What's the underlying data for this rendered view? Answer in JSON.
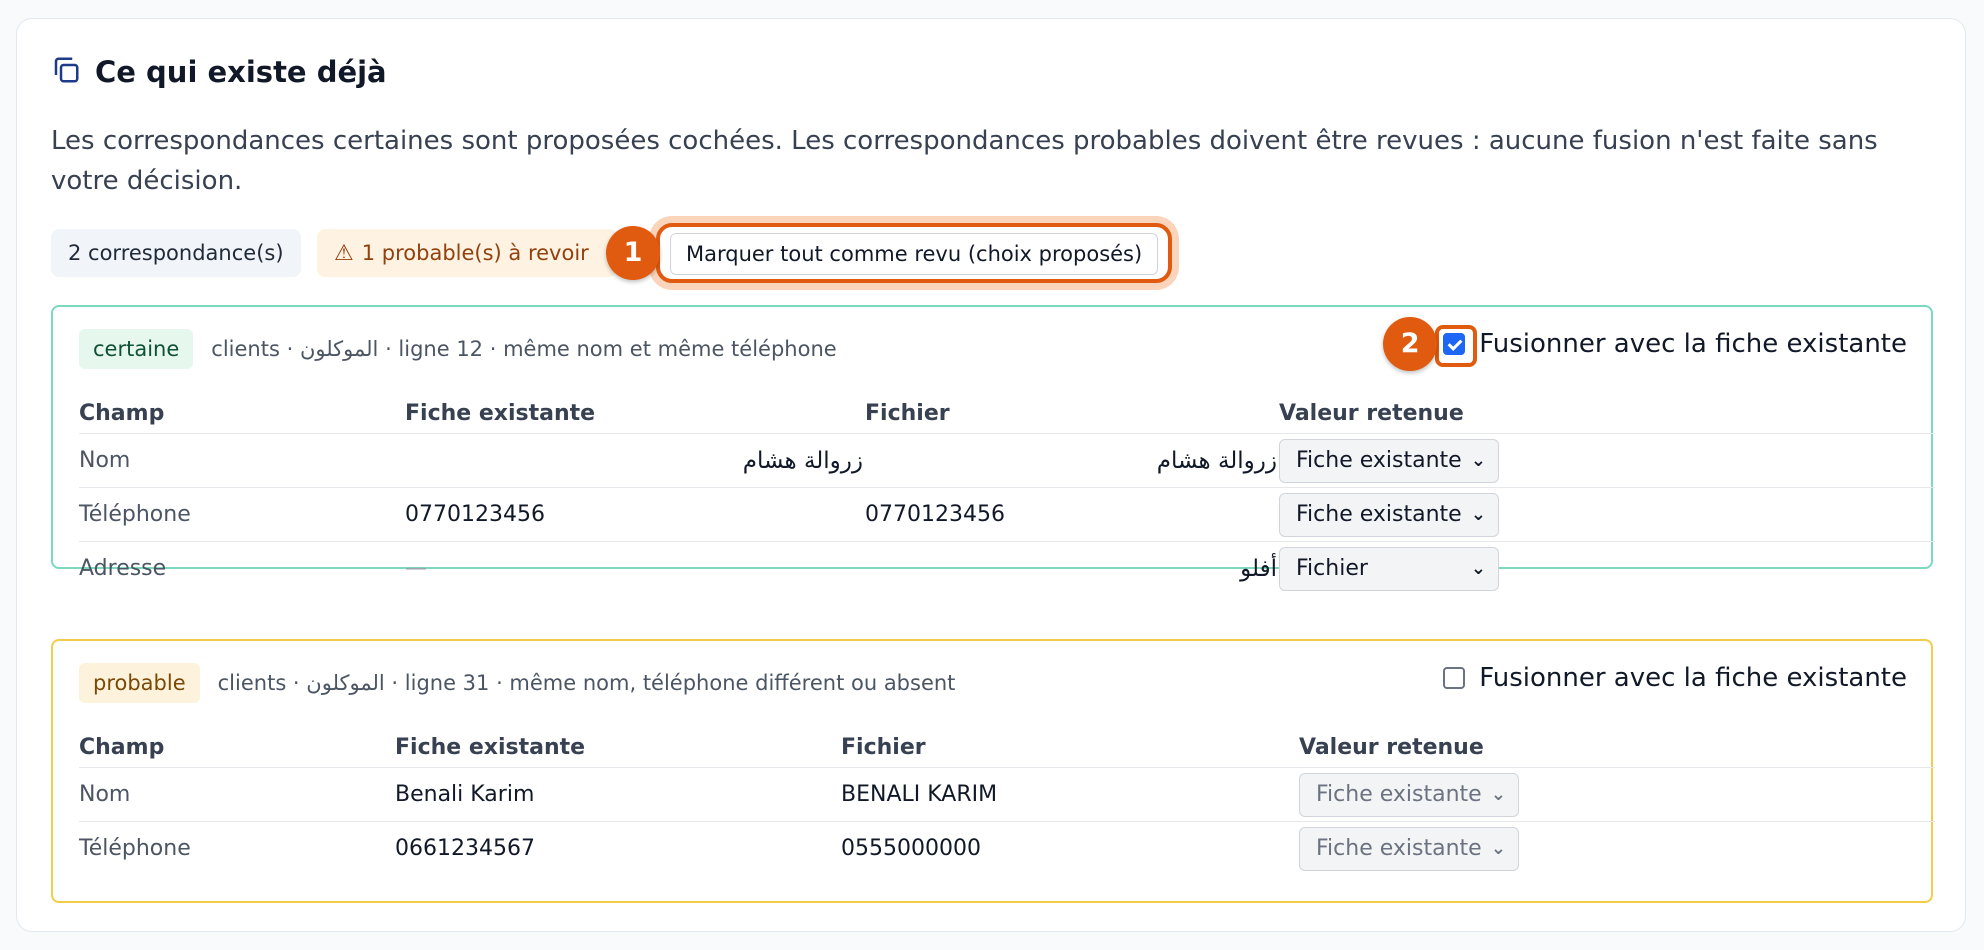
{
  "section": {
    "title": "Ce qui existe déjà",
    "icon": "copy-icon",
    "intro": "Les correspondances certaines sont proposées cochées. Les correspondances probables doivent être revues : aucune fusion n'est faite sans votre décision."
  },
  "summary": {
    "matches": "2 correspondance(s)",
    "probable": "1 probable(s) à revoir",
    "mark_all_button": "Marquer tout comme revu (choix proposés)"
  },
  "annotations": {
    "one": "1",
    "two": "2"
  },
  "colors": {
    "accent": "#e05a0f",
    "certain_border": "#7cd9bd",
    "probable_border": "#f3cd4a",
    "checkbox": "#1e66f5"
  },
  "groups": [
    {
      "tag": "certaine",
      "meta": "clients · الموكلون · ligne 12 · même nom et même téléphone",
      "merge_label": "Fusionner avec la fiche existante",
      "merge_checked": true,
      "headers": {
        "field": "Champ",
        "existing": "Fiche existante",
        "file": "Fichier",
        "kept": "Valeur retenue"
      },
      "rows": [
        {
          "field": "Nom",
          "existing": "زروالة هشام",
          "file": "زروالة هشام",
          "kept": "Fiche existante"
        },
        {
          "field": "Téléphone",
          "existing": "0770123456",
          "file": "0770123456",
          "kept": "Fiche existante"
        },
        {
          "field": "Adresse",
          "existing": "—",
          "file": "أفلو",
          "kept": "Fichier"
        }
      ]
    },
    {
      "tag": "probable",
      "meta": "clients · الموكلون · ligne 31 · même nom, téléphone différent ou absent",
      "merge_label": "Fusionner avec la fiche existante",
      "merge_checked": false,
      "headers": {
        "field": "Champ",
        "existing": "Fiche existante",
        "file": "Fichier",
        "kept": "Valeur retenue"
      },
      "rows": [
        {
          "field": "Nom",
          "existing": "Benali Karim",
          "file": "BENALI KARIM",
          "kept": "Fiche existante"
        },
        {
          "field": "Téléphone",
          "existing": "0661234567",
          "file": "0555000000",
          "kept": "Fiche existante"
        }
      ]
    }
  ]
}
